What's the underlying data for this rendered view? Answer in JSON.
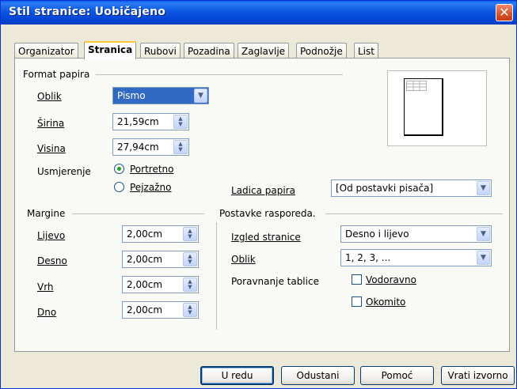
{
  "window": {
    "title": "Stil stranice: Uobičajeno"
  },
  "tabs": [
    "Organizator",
    "Stranica",
    "Rubovi",
    "Pozadina",
    "Zaglavlje",
    "Podnožje",
    "List"
  ],
  "active_tab": "Stranica",
  "paper_format": {
    "header": "Format papira",
    "format_label": "Oblik",
    "format_value": "Pismo",
    "width_label": "Širina",
    "width_value": "21,59cm",
    "height_label": "Visina",
    "height_value": "27,94cm",
    "orientation_label": "Usmjerenje",
    "portrait_label": "Portretno",
    "landscape_label": "Pejzažno",
    "portrait_selected": true,
    "tray_label": "Ladica papira",
    "tray_value": "[Od postavki pisača]"
  },
  "margins": {
    "header": "Margine",
    "left_label": "Lijevo",
    "left_value": "2,00cm",
    "right_label": "Desno",
    "right_value": "2,00cm",
    "top_label": "Vrh",
    "top_value": "2,00cm",
    "bottom_label": "Dno",
    "bottom_value": "2,00cm"
  },
  "layout": {
    "header": "Postavke rasporeda.",
    "page_layout_label": "Izgled stranice",
    "page_layout_value": "Desno i lijevo",
    "format_label": "Oblik",
    "format_value": "1, 2, 3, ...",
    "table_alignment_label": "Poravnanje tablice",
    "horizontal_label": "Vodoravno",
    "vertical_label": "Okomito",
    "horizontal_checked": false,
    "vertical_checked": false
  },
  "buttons": {
    "ok": "U redu",
    "cancel": "Odustani",
    "help": "Pomoć",
    "reset": "Vrati izvorno"
  }
}
